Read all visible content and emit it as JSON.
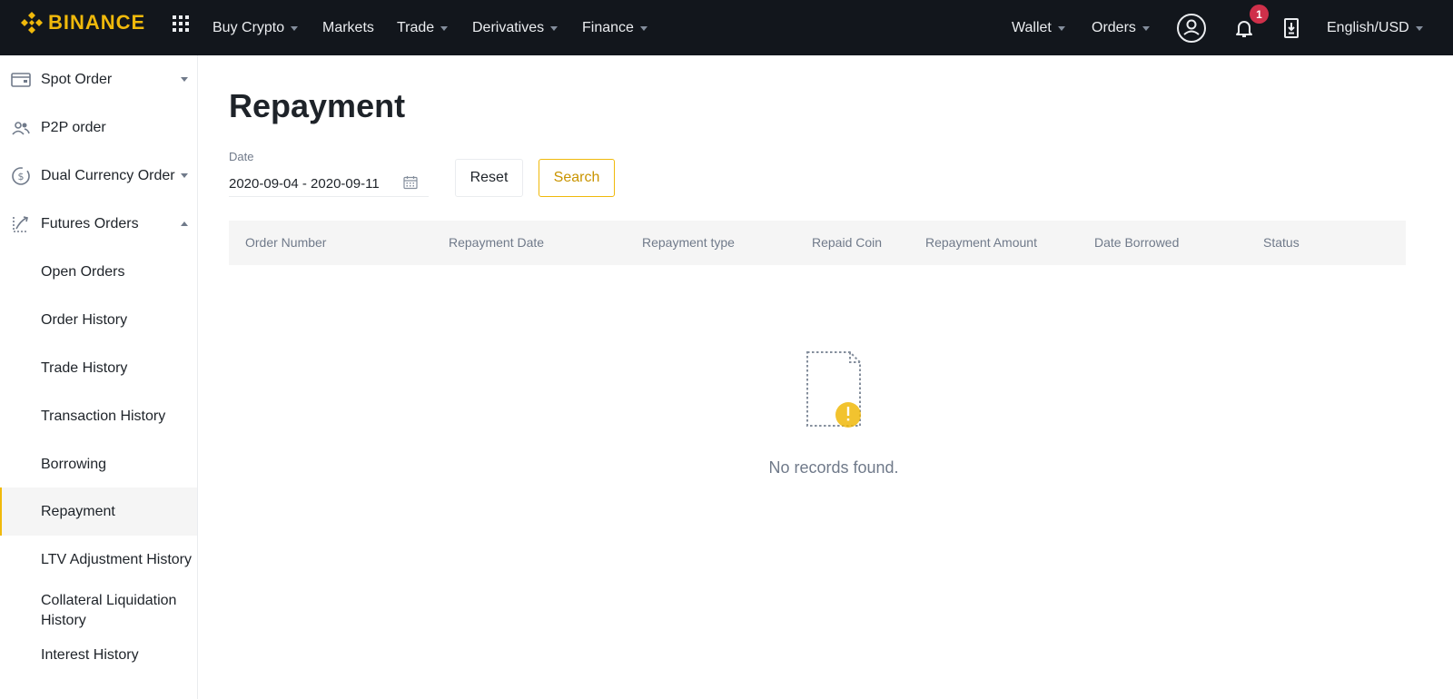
{
  "brand": {
    "name": "BINANCE",
    "accent": "#f0b90b"
  },
  "nav": {
    "items": [
      {
        "label": "Buy Crypto",
        "dropdown": true
      },
      {
        "label": "Markets",
        "dropdown": false
      },
      {
        "label": "Trade",
        "dropdown": true
      },
      {
        "label": "Derivatives",
        "dropdown": true
      },
      {
        "label": "Finance",
        "dropdown": true
      }
    ],
    "right": {
      "wallet": "Wallet",
      "orders": "Orders",
      "notification_count": "1",
      "language": "English/USD"
    }
  },
  "sidebar": {
    "items": [
      {
        "label": "Spot Order",
        "icon": "wallet-card-icon"
      },
      {
        "label": "P2P order",
        "icon": "users-icon"
      },
      {
        "label": "Dual Currency Order",
        "icon": "dollar-coin-icon"
      },
      {
        "label": "Futures Orders",
        "icon": "futures-icon"
      },
      {
        "label": "Open Orders"
      },
      {
        "label": "Order History"
      },
      {
        "label": "Trade History"
      },
      {
        "label": "Transaction History"
      },
      {
        "label": "Borrowing"
      },
      {
        "label": "Repayment",
        "active": true
      },
      {
        "label": "LTV Adjustment History"
      },
      {
        "label": "Collateral Liquidation History"
      },
      {
        "label": "Interest History"
      }
    ]
  },
  "main": {
    "title": "Repayment",
    "filter": {
      "date_label": "Date",
      "date_value": "2020-09-04 - 2020-09-11",
      "reset_label": "Reset",
      "search_label": "Search"
    },
    "table": {
      "columns": [
        "Order Number",
        "Repayment Date",
        "Repayment type",
        "Repaid Coin",
        "Repayment Amount",
        "Date Borrowed",
        "Status"
      ],
      "rows": []
    },
    "empty_message": "No records found."
  }
}
